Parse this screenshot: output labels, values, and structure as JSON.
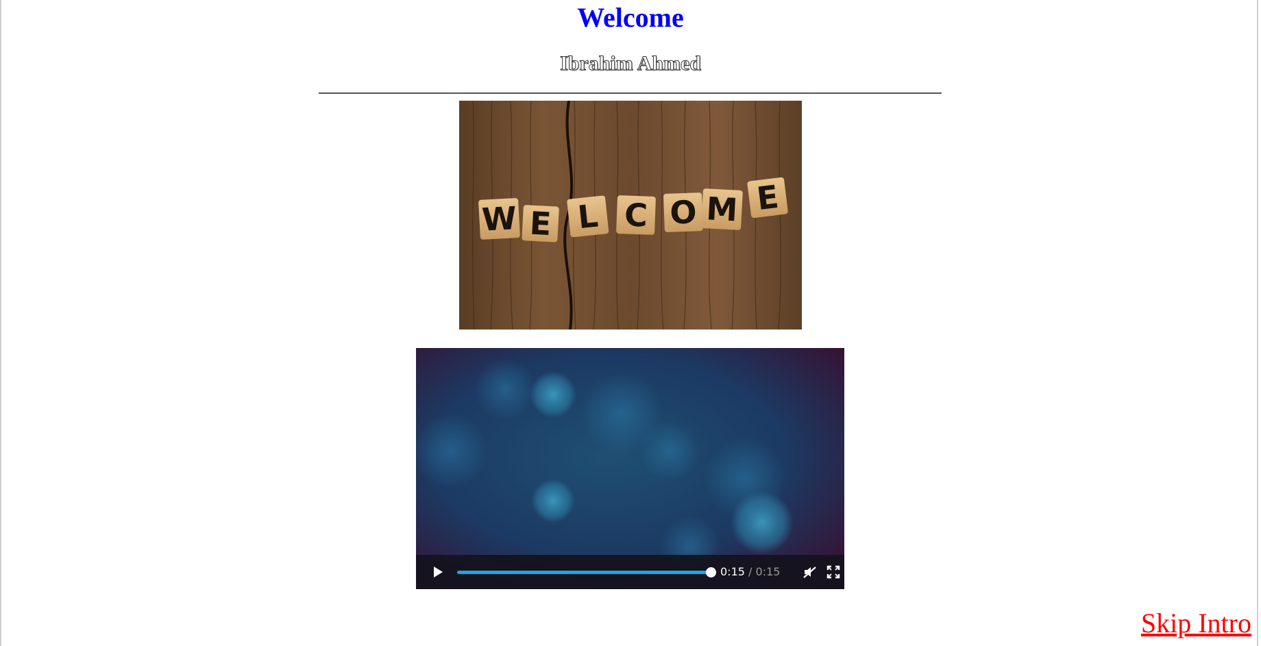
{
  "header": {
    "title": "Welcome",
    "subtitle": "Ibrahim Ahmed"
  },
  "image": {
    "tiles_text": [
      "W",
      "E",
      "L",
      "C",
      "O",
      "M",
      "E"
    ]
  },
  "video": {
    "current_time": "0:15",
    "separator": "/",
    "duration": "0:15",
    "progress": 1.0,
    "accent_color": "#1aa7e6",
    "icons": [
      "play-icon",
      "muted-speaker-icon",
      "fullscreen-icon"
    ]
  },
  "footer": {
    "skip_label": "Skip Intro"
  },
  "colors": {
    "title": "#0000ff",
    "skip_link": "#ff0000"
  }
}
